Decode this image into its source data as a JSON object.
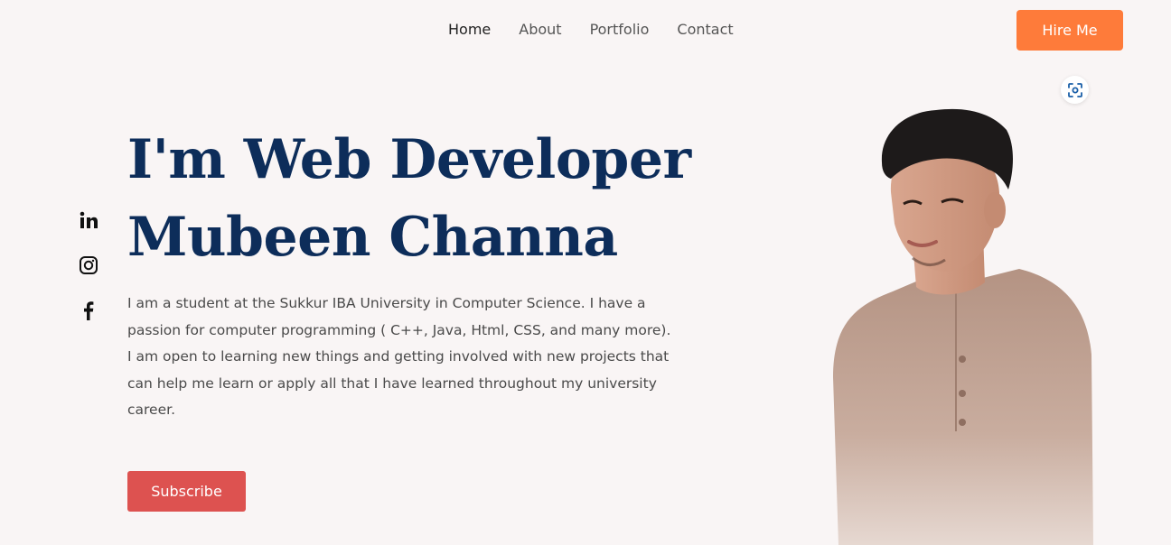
{
  "nav": {
    "items": [
      {
        "label": "Home",
        "active": true
      },
      {
        "label": "About",
        "active": false
      },
      {
        "label": "Portfolio",
        "active": false
      },
      {
        "label": "Contact",
        "active": false
      }
    ],
    "hire_label": "Hire Me"
  },
  "hero": {
    "line1": "I'm Web Developer",
    "line2": "Mubeen Channa",
    "paragraph1": "I am a student at the Sukkur IBA University in Computer Science. I have a passion for computer programming ( C++, Java, Html, CSS, and many more).",
    "paragraph2": "I am open to learning new things and getting involved with new projects that can help me learn or apply all that I have learned throughout my university career.",
    "subscribe_label": "Subscribe"
  },
  "social": {
    "icons": [
      "linkedin-icon",
      "instagram-icon",
      "facebook-icon"
    ]
  },
  "colors": {
    "background": "#f9f5f5",
    "headline": "#0d2d5a",
    "hire_button": "#fe7b3a",
    "subscribe_button": "#dd5250"
  },
  "icons": {
    "scan": "scan-icon",
    "portrait": "portrait-photo"
  }
}
